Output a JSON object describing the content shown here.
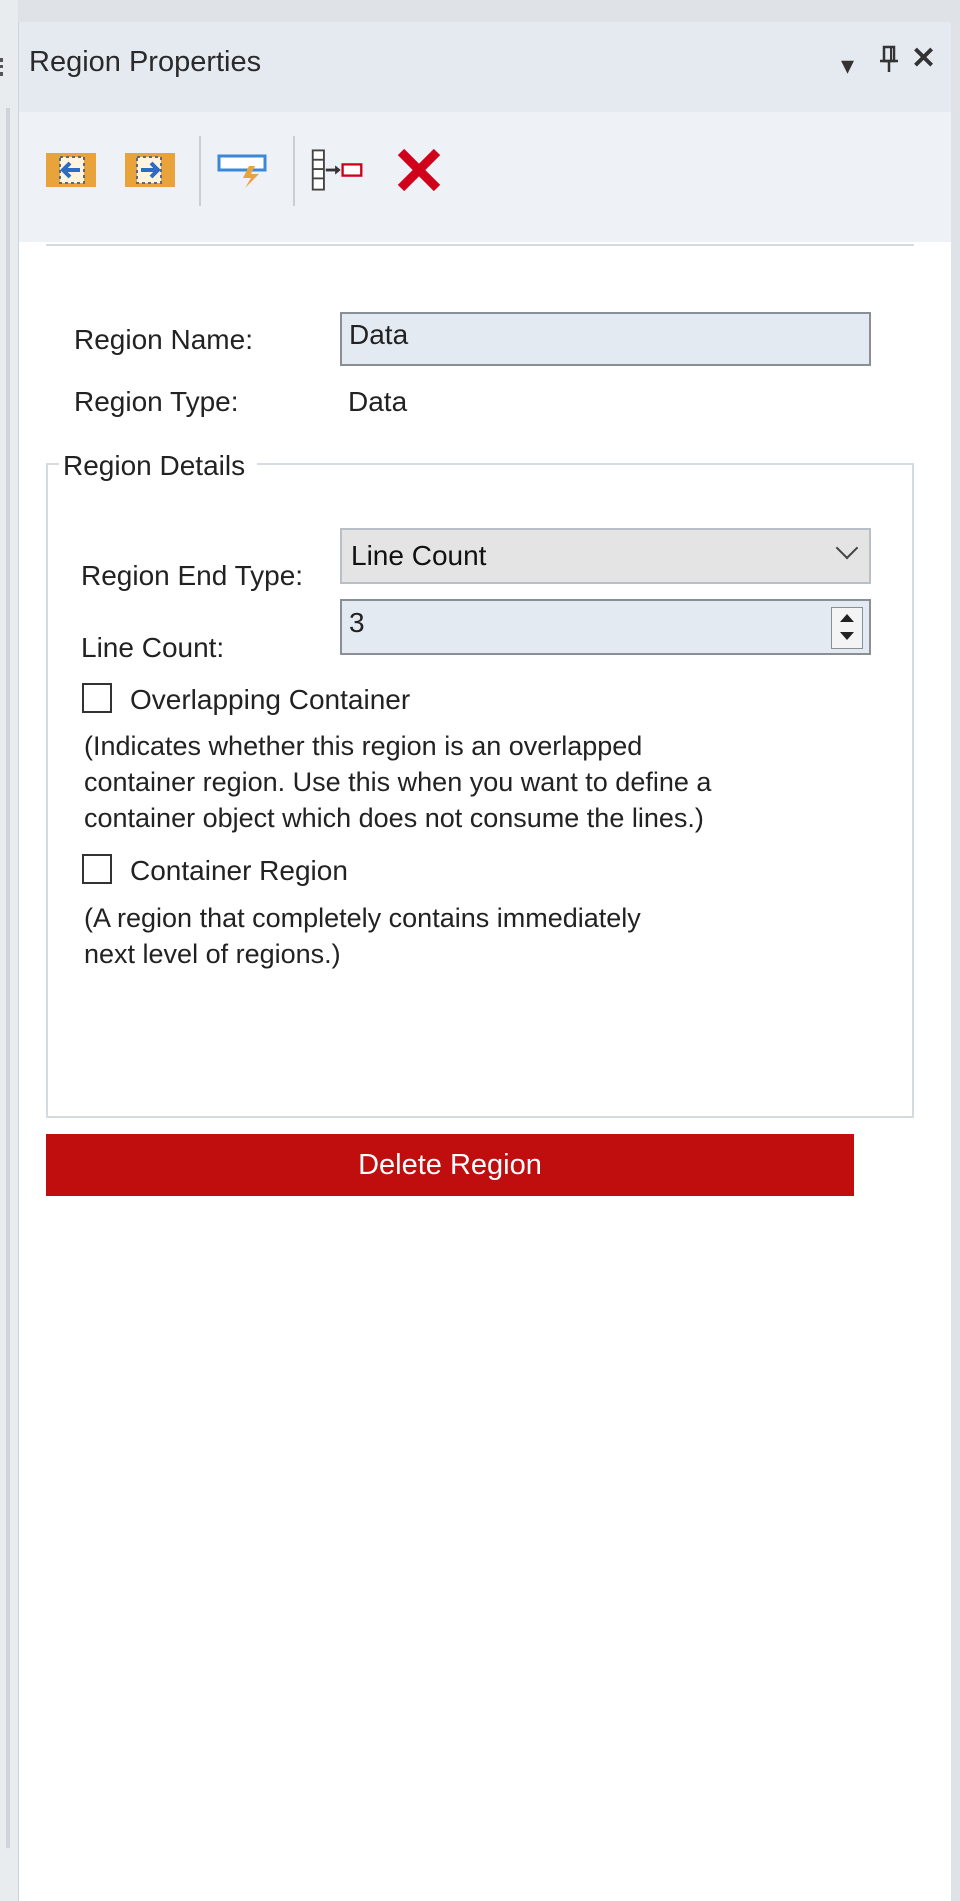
{
  "panel": {
    "title": "Region Properties",
    "controls": {
      "dropdown": "▾",
      "pin": "ꟼ",
      "close": "✕"
    }
  },
  "toolbar": {
    "buttons": [
      {
        "name": "move-left-icon",
        "color": "#e8a33a"
      },
      {
        "name": "move-right-icon",
        "color": "#e8a33a"
      },
      {
        "name": "convert-region-icon",
        "color": "#3b87d8"
      },
      {
        "name": "insert-column-icon",
        "color": "#444444"
      },
      {
        "name": "delete-icon",
        "color": "#d0021b"
      }
    ]
  },
  "form": {
    "region_name_label": "Region Name:",
    "region_name_value": "Data",
    "region_type_label": "Region Type:",
    "region_type_value": "Data"
  },
  "details": {
    "legend": "Region Details",
    "end_type_label": "Region End Type:",
    "end_type_value": "Line Count",
    "line_count_label": "Line Count:",
    "line_count_value": "3",
    "overlapping_label": "Overlapping Container",
    "overlapping_checked": false,
    "overlapping_desc": [
      "(Indicates whether this region is an overlapped",
      "container region. Use this when you want to define a",
      "container object which does not consume the lines.)"
    ],
    "container_label": "Container Region",
    "container_checked": false,
    "container_desc": [
      "(A region that completely contains immediately",
      "next level of regions.)"
    ]
  },
  "actions": {
    "delete_label": "Delete Region",
    "delete_color": "#c00d0d"
  }
}
